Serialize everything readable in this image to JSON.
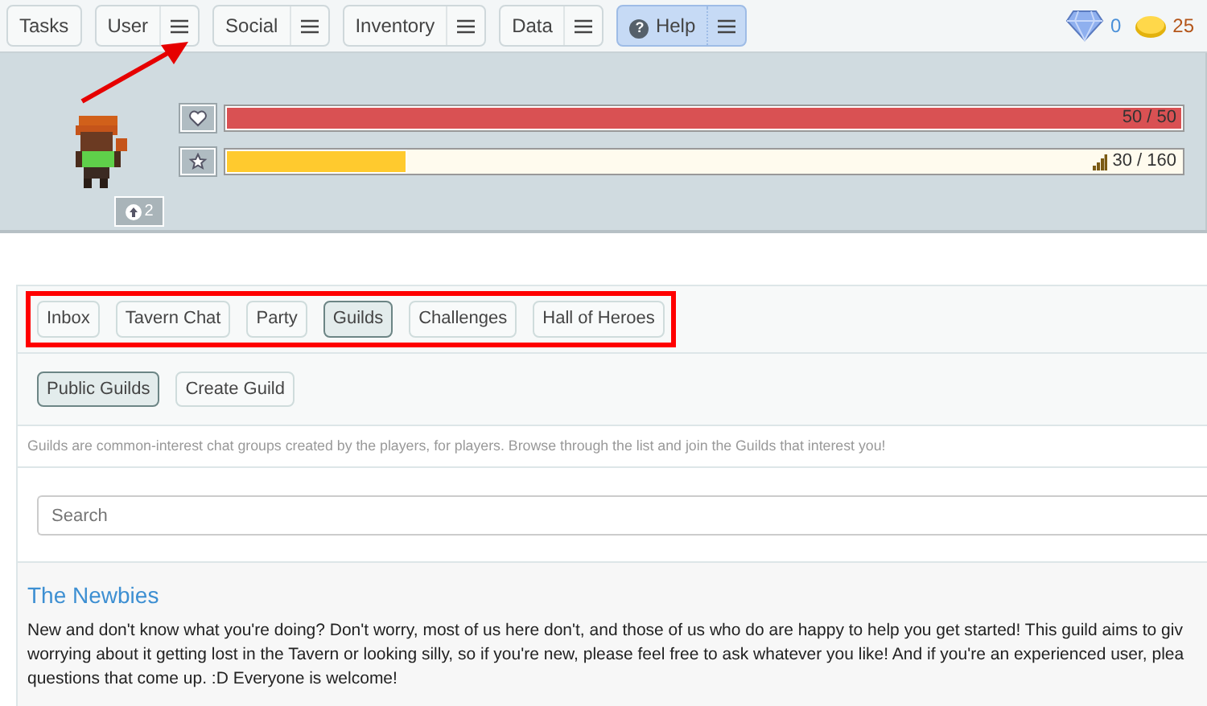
{
  "nav": {
    "items": [
      {
        "label": "Tasks",
        "has_menu": false,
        "highlighted": false
      },
      {
        "label": "User",
        "has_menu": true,
        "highlighted": false
      },
      {
        "label": "Social",
        "has_menu": true,
        "highlighted": false
      },
      {
        "label": "Inventory",
        "has_menu": true,
        "highlighted": false
      },
      {
        "label": "Data",
        "has_menu": true,
        "highlighted": false
      },
      {
        "label": "Help",
        "has_menu": true,
        "highlighted": true,
        "icon": "?"
      }
    ]
  },
  "currency": {
    "gems": "0",
    "gold": "25"
  },
  "avatar": {
    "badge": "2"
  },
  "bars": [
    {
      "kind": "health",
      "level": 1,
      "reading": "50 / 50"
    },
    {
      "kind": "experience",
      "level": 0.19,
      "reading": "30 / 160"
    }
  ],
  "tabs": [
    {
      "label": "Inbox",
      "selected": false
    },
    {
      "label": "Tavern Chat",
      "selected": false
    },
    {
      "label": "Party",
      "selected": false
    },
    {
      "label": "Guilds",
      "selected": true
    },
    {
      "label": "Challenges",
      "selected": false
    },
    {
      "label": "Hall of Heroes",
      "selected": false
    }
  ],
  "subtabs": [
    {
      "label": "Public Guilds",
      "selected": true
    },
    {
      "label": "Create Guild",
      "selected": false
    }
  ],
  "intro": "Guilds are common-interest chat groups created by the players, for players. Browse through the list and join the Guilds that interest you!",
  "search": {
    "placeholder": "Search"
  },
  "guilds": [
    {
      "name": "The Newbies",
      "description_lines": [
        "New and don't know what you're doing? Don't worry, most of us here don't, and those of us who do are happy to help you get started! This guild aims to giv",
        "worrying about it getting lost in the Tavern or looking silly, so if you're new, please feel free to ask whatever you like! And if you're an experienced user, plea",
        "questions that come up. :D Everyone is welcome!"
      ]
    }
  ]
}
